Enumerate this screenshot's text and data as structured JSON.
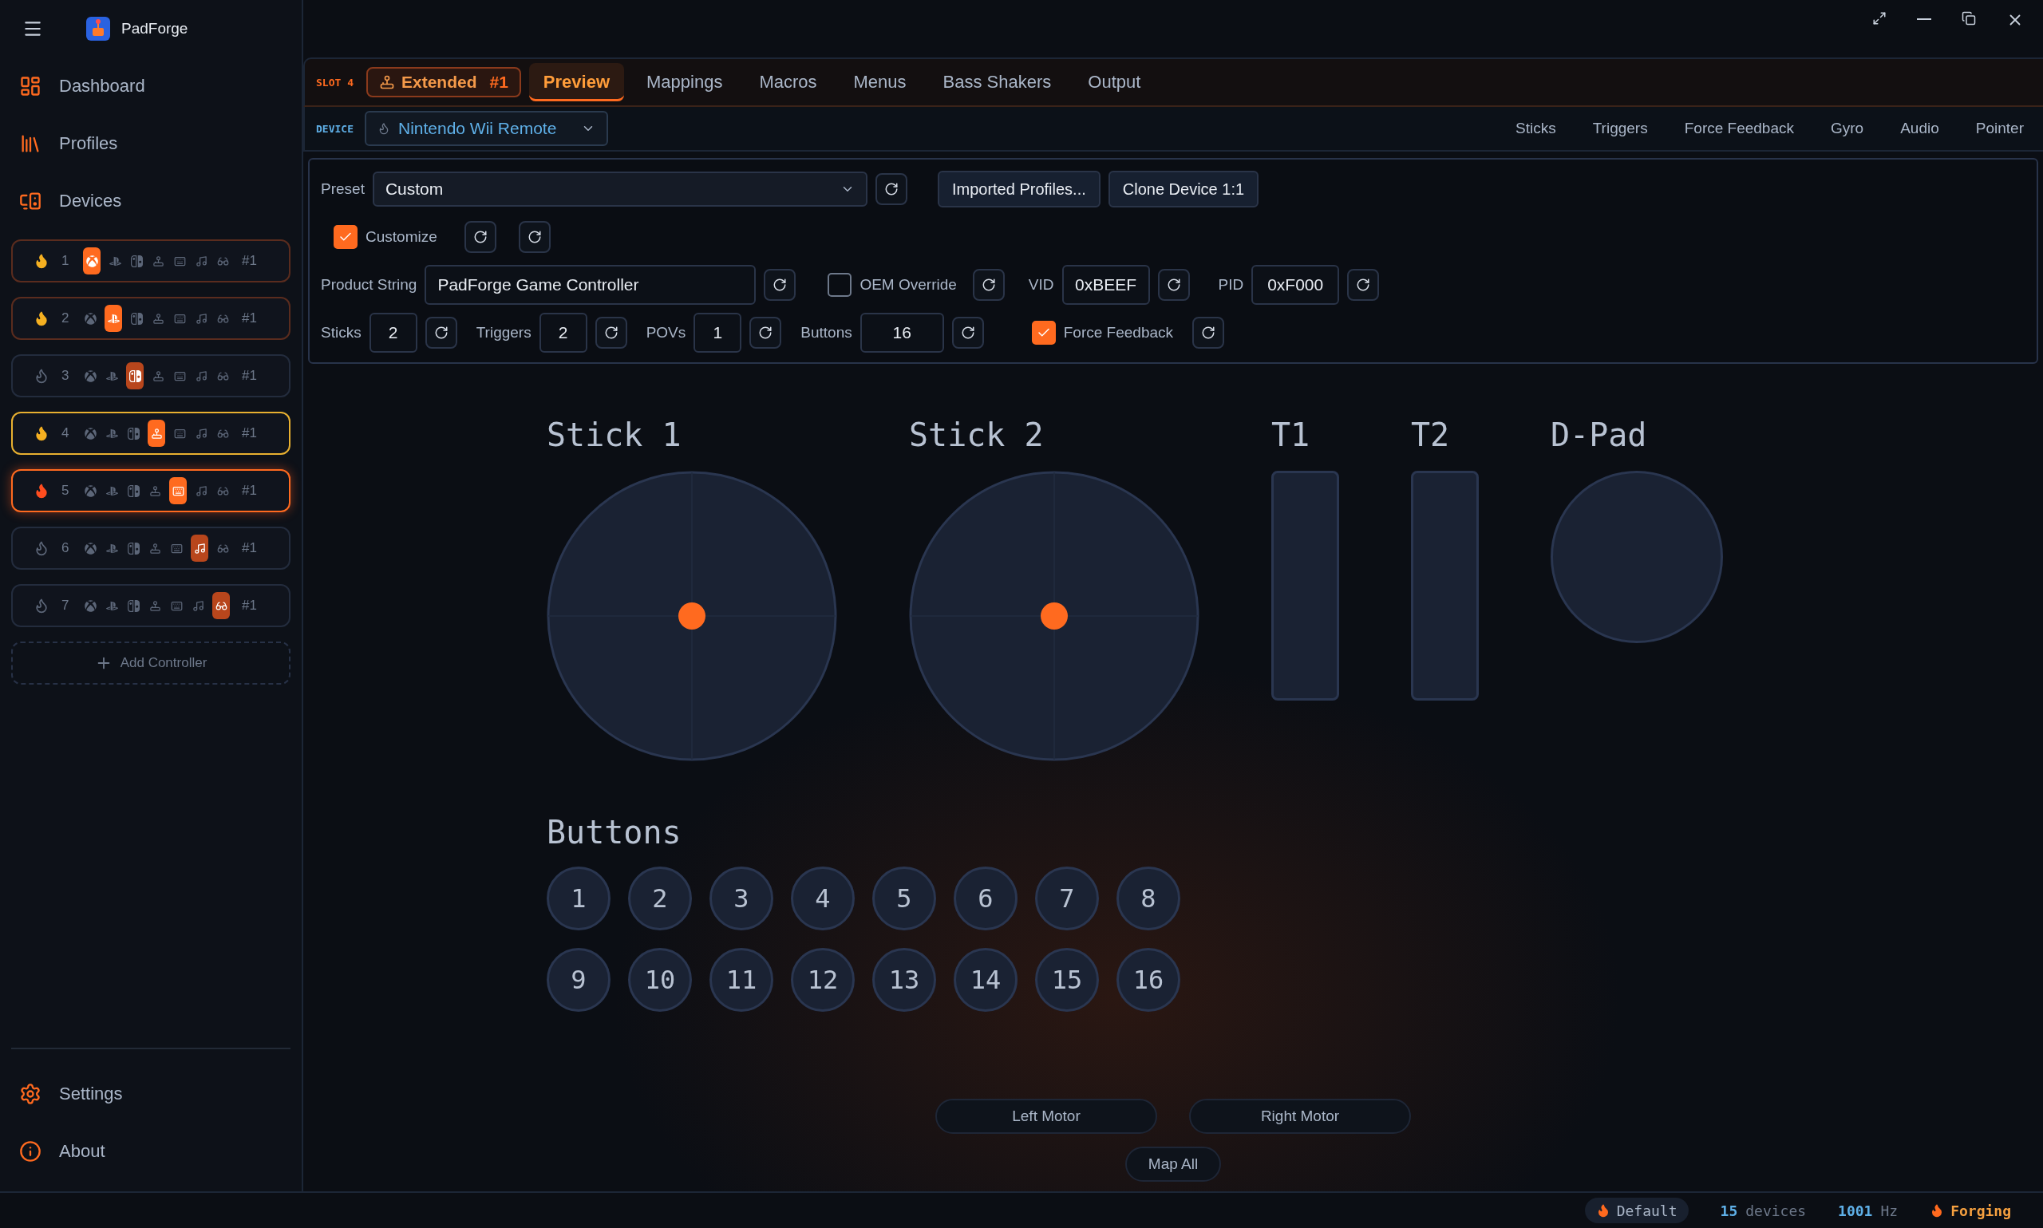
{
  "app": {
    "title": "PadForge"
  },
  "nav": [
    {
      "label": "Dashboard",
      "kind": "dashboard"
    },
    {
      "label": "Profiles",
      "kind": "profiles"
    },
    {
      "label": "Devices",
      "kind": "devices"
    }
  ],
  "slots": [
    {
      "number": "1",
      "tag": "#1",
      "color": "#f5b021",
      "active": true,
      "glow": false,
      "selected": false,
      "icons": [
        {
          "kind": "xbox",
          "selected": true
        },
        {
          "kind": "playstation",
          "selected": false
        },
        {
          "kind": "switch",
          "selected": false
        },
        {
          "kind": "joystick",
          "selected": false
        },
        {
          "kind": "keyboard",
          "selected": false
        },
        {
          "kind": "music",
          "selected": false
        },
        {
          "kind": "goggles",
          "selected": false
        }
      ]
    },
    {
      "number": "2",
      "tag": "#1",
      "color": "#f5b021",
      "active": true,
      "glow": false,
      "selected": false,
      "icons": [
        {
          "kind": "xbox",
          "selected": false
        },
        {
          "kind": "playstation",
          "selected": true
        },
        {
          "kind": "switch",
          "selected": false
        },
        {
          "kind": "joystick",
          "selected": false
        },
        {
          "kind": "keyboard",
          "selected": false
        },
        {
          "kind": "music",
          "selected": false
        },
        {
          "kind": "goggles",
          "selected": false
        }
      ]
    },
    {
      "number": "3",
      "tag": "#1",
      "color": "#5c6678",
      "active": false,
      "glow": false,
      "selected": false,
      "icons": [
        {
          "kind": "xbox",
          "selected": false
        },
        {
          "kind": "playstation",
          "selected": false
        },
        {
          "kind": "switch",
          "selected": true
        },
        {
          "kind": "joystick",
          "selected": false
        },
        {
          "kind": "keyboard",
          "selected": false
        },
        {
          "kind": "music",
          "selected": false
        },
        {
          "kind": "goggles",
          "selected": false
        }
      ]
    },
    {
      "number": "4",
      "tag": "#1",
      "color": "#f5b021",
      "active": true,
      "glow": false,
      "selected": true,
      "icons": [
        {
          "kind": "xbox",
          "selected": false
        },
        {
          "kind": "playstation",
          "selected": false
        },
        {
          "kind": "switch",
          "selected": false
        },
        {
          "kind": "joystick",
          "selected": true
        },
        {
          "kind": "keyboard",
          "selected": false
        },
        {
          "kind": "music",
          "selected": false
        },
        {
          "kind": "goggles",
          "selected": false
        }
      ]
    },
    {
      "number": "5",
      "tag": "#1",
      "color": "#ff4d1f",
      "active": true,
      "glow": true,
      "selected": false,
      "icons": [
        {
          "kind": "xbox",
          "selected": false
        },
        {
          "kind": "playstation",
          "selected": false
        },
        {
          "kind": "switch",
          "selected": false
        },
        {
          "kind": "joystick",
          "selected": false
        },
        {
          "kind": "keyboard",
          "selected": true
        },
        {
          "kind": "music",
          "selected": false
        },
        {
          "kind": "goggles",
          "selected": false
        }
      ]
    },
    {
      "number": "6",
      "tag": "#1",
      "color": "#5c6678",
      "active": false,
      "glow": false,
      "selected": false,
      "icons": [
        {
          "kind": "xbox",
          "selected": false
        },
        {
          "kind": "playstation",
          "selected": false
        },
        {
          "kind": "switch",
          "selected": false
        },
        {
          "kind": "joystick",
          "selected": false
        },
        {
          "kind": "keyboard",
          "selected": false
        },
        {
          "kind": "music",
          "selected": true
        },
        {
          "kind": "goggles",
          "selected": false
        }
      ]
    },
    {
      "number": "7",
      "tag": "#1",
      "color": "#5c6678",
      "active": false,
      "glow": false,
      "selected": false,
      "icons": [
        {
          "kind": "xbox",
          "selected": false
        },
        {
          "kind": "playstation",
          "selected": false
        },
        {
          "kind": "switch",
          "selected": false
        },
        {
          "kind": "joystick",
          "selected": false
        },
        {
          "kind": "keyboard",
          "selected": false
        },
        {
          "kind": "music",
          "selected": false
        },
        {
          "kind": "goggles",
          "selected": true
        }
      ]
    }
  ],
  "add_controller": "Add Controller",
  "footer_nav": [
    {
      "label": "Settings",
      "kind": "settings"
    },
    {
      "label": "About",
      "kind": "about"
    }
  ],
  "slot_header": {
    "label": "SLOT 4",
    "badge": "Extended",
    "badge_tag": "#1"
  },
  "tabs": [
    {
      "label": "Preview",
      "selected": true
    },
    {
      "label": "Mappings",
      "selected": false
    },
    {
      "label": "Macros",
      "selected": false
    },
    {
      "label": "Menus",
      "selected": false
    },
    {
      "label": "Bass Shakers",
      "selected": false
    },
    {
      "label": "Output",
      "selected": false
    }
  ],
  "device": {
    "label": "DEVICE",
    "value": "Nintendo Wii Remote"
  },
  "sections": [
    "Sticks",
    "Triggers",
    "Force Feedback",
    "Gyro",
    "Audio",
    "Pointer"
  ],
  "settings": {
    "preset_label": "Preset",
    "preset": "Custom",
    "imported": "Imported Profiles...",
    "clone": "Clone Device 1:1",
    "customize": {
      "label": "Customize",
      "checked": true
    },
    "product_label": "Product String",
    "product": "PadForge Game Controller",
    "oem": {
      "label": "OEM Override",
      "checked": false
    },
    "vid_label": "VID",
    "vid": "0xBEEF",
    "pid_label": "PID",
    "pid": "0xF000",
    "counts": [
      {
        "label": "Sticks",
        "value": "2"
      },
      {
        "label": "Triggers",
        "value": "2"
      },
      {
        "label": "POVs",
        "value": "1"
      },
      {
        "label": "Buttons",
        "value": "16"
      }
    ],
    "force_feedback": {
      "label": "Force Feedback",
      "checked": true
    }
  },
  "preview": {
    "sticks": [
      {
        "label": "Stick 1"
      },
      {
        "label": "Stick 2"
      }
    ],
    "triggers": [
      {
        "label": "T1",
        "level": 0
      },
      {
        "label": "T2",
        "level": 0
      }
    ],
    "dpad": {
      "label": "D-Pad"
    },
    "buttons_title": "Buttons",
    "buttons": [
      "1",
      "2",
      "3",
      "4",
      "5",
      "6",
      "7",
      "8",
      "9",
      "10",
      "11",
      "12",
      "13",
      "14",
      "15",
      "16"
    ],
    "motors": [
      "Left Motor",
      "Right Motor"
    ],
    "map_all": "Map All"
  },
  "status": {
    "profile": "Default",
    "devices": {
      "count": "15",
      "unit": "devices"
    },
    "rate": {
      "count": "1001",
      "unit": "Hz"
    },
    "engine": "Forging"
  }
}
